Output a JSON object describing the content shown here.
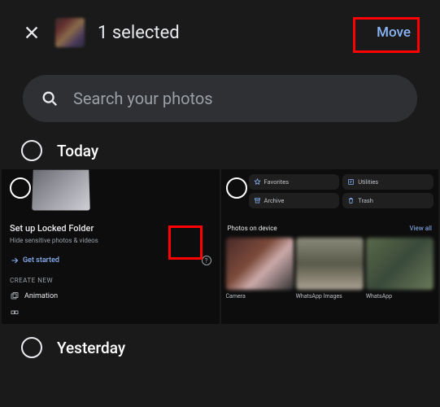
{
  "header": {
    "selection_label": "1 selected",
    "move_label": "Move"
  },
  "search": {
    "placeholder": "Search your photos"
  },
  "sections": {
    "today": "Today",
    "yesterday": "Yesterday"
  },
  "tile1": {
    "title": "Set up Locked Folder",
    "subtitle": "Hide sensitive photos & videos",
    "cta": "Get started",
    "create_header": "CREATE NEW",
    "animation": "Animation"
  },
  "tile2": {
    "chips": {
      "favorites": "Favorites",
      "utilities": "Utilities",
      "archive": "Archive",
      "trash": "Trash"
    },
    "photos_label": "Photos on device",
    "view_all": "View all",
    "captions": [
      "Camera",
      "WhatsApp Images",
      "WhatsApp"
    ]
  }
}
